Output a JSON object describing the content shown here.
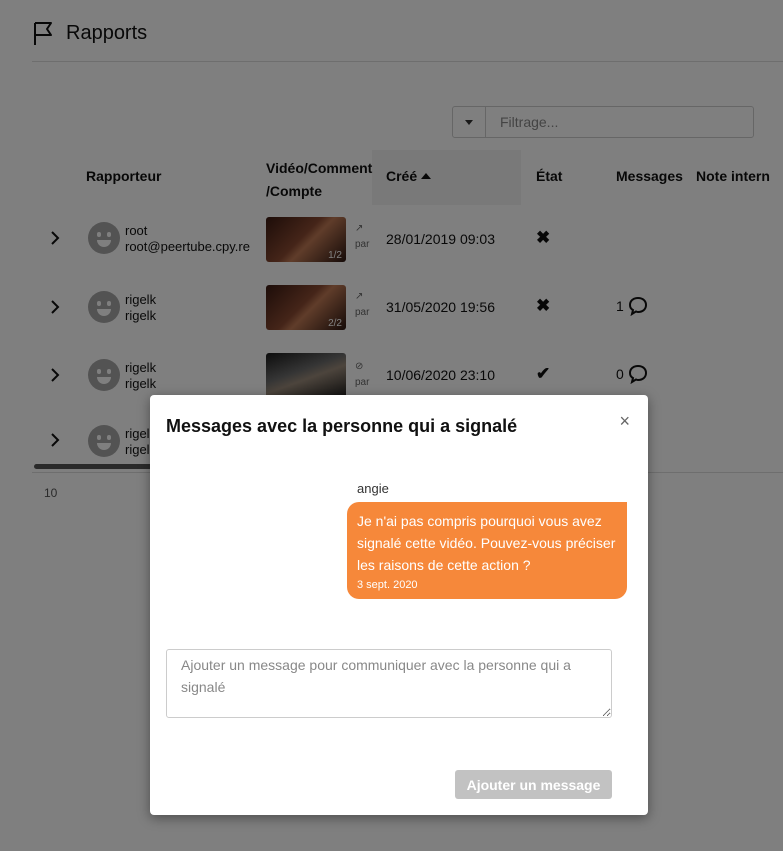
{
  "page": {
    "title": "Rapports"
  },
  "filter": {
    "placeholder": "Filtrage..."
  },
  "table": {
    "headers": {
      "reporter": "Rapporteur",
      "video_line1": "Vidéo/Comment",
      "video_line2": "/Compte",
      "created": "Créé",
      "state": "État",
      "messages": "Messages",
      "note": "Note intern"
    },
    "rows": [
      {
        "reporter_name": "root",
        "reporter_account": "root@peertube.cpy.re",
        "thumb_badge": "1/2",
        "side_text": "par",
        "created": "28/01/2019 09:03",
        "state": "✖",
        "messages": ""
      },
      {
        "reporter_name": "rigelk",
        "reporter_account": "rigelk",
        "thumb_badge": "2/2",
        "side_text": "par",
        "created": "31/05/2020 19:56",
        "state": "✖",
        "messages": "1"
      },
      {
        "reporter_name": "rigelk",
        "reporter_account": "rigelk",
        "thumb_badge": "",
        "side_text": "par",
        "created": "10/06/2020 23:10",
        "state": "✔",
        "messages": "0"
      },
      {
        "reporter_name": "rigel",
        "reporter_account": "rigel",
        "thumb_badge": "",
        "side_text": "",
        "created": "",
        "state": "",
        "messages": ""
      }
    ]
  },
  "pagination": {
    "per_page": "10"
  },
  "modal": {
    "title": "Messages avec la personne qui a signalé",
    "close": "×",
    "messages": [
      {
        "author": "angie",
        "text": "Je n'ai pas compris pourquoi vous avez signalé cette vidéo. Pouvez-vous préciser les raisons de cette action ?",
        "date": "3 sept. 2020"
      }
    ],
    "compose_placeholder": "Ajouter un message pour communiquer avec la personne qui a signalé",
    "send_label": "Ajouter un message"
  },
  "colors": {
    "accent": "#f6883a",
    "overlay": "rgba(0,0,0,0.5)",
    "disabled_button": "#c2c2c2"
  }
}
